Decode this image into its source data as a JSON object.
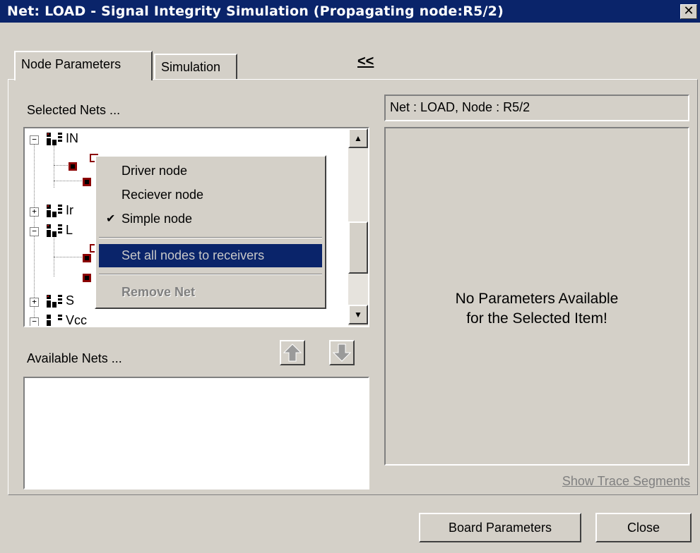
{
  "window": {
    "title": "Net: LOAD - Signal Integrity Simulation  (Propagating node:R5/2)",
    "close_glyph": "✕"
  },
  "tabs": [
    {
      "label": "Node Parameters",
      "active": true
    },
    {
      "label": "Simulation",
      "active": false
    }
  ],
  "collapse_label": "<<",
  "selected_nets": {
    "label": "Selected Nets ...",
    "tree": [
      {
        "type": "net",
        "expander": "−",
        "label": "IN"
      },
      {
        "type": "net",
        "expander": "+",
        "label": "Ir"
      },
      {
        "type": "net",
        "expander": "−",
        "label": "L"
      },
      {
        "type": "net",
        "expander": "+",
        "label": "S"
      },
      {
        "type": "net",
        "expander": "−",
        "label": "Vcc"
      }
    ]
  },
  "context_menu": {
    "items": [
      {
        "label": "Driver node",
        "checked": false,
        "highlighted": false,
        "disabled": false
      },
      {
        "label": "Reciever node",
        "checked": false,
        "highlighted": false,
        "disabled": false
      },
      {
        "label": "Simple node",
        "checked": true,
        "highlighted": false,
        "disabled": false
      },
      {
        "label": "Set all nodes to receivers",
        "checked": false,
        "highlighted": true,
        "disabled": false
      },
      {
        "label": "Remove Net",
        "checked": false,
        "highlighted": false,
        "disabled": true
      }
    ]
  },
  "available_nets": {
    "label": "Available Nets ..."
  },
  "node_info": "Net : LOAD, Node : R5/2",
  "params_message": {
    "line1": "No Parameters Available",
    "line2": "for the Selected Item!"
  },
  "show_trace_segments": "Show Trace Segments",
  "buttons": {
    "board_parameters": "Board Parameters",
    "close": "Close"
  },
  "colors": {
    "title_bar": "#0a246a",
    "face": "#d4d0c8",
    "highlight": "#0a246a",
    "node_icon": "#8b0000"
  }
}
